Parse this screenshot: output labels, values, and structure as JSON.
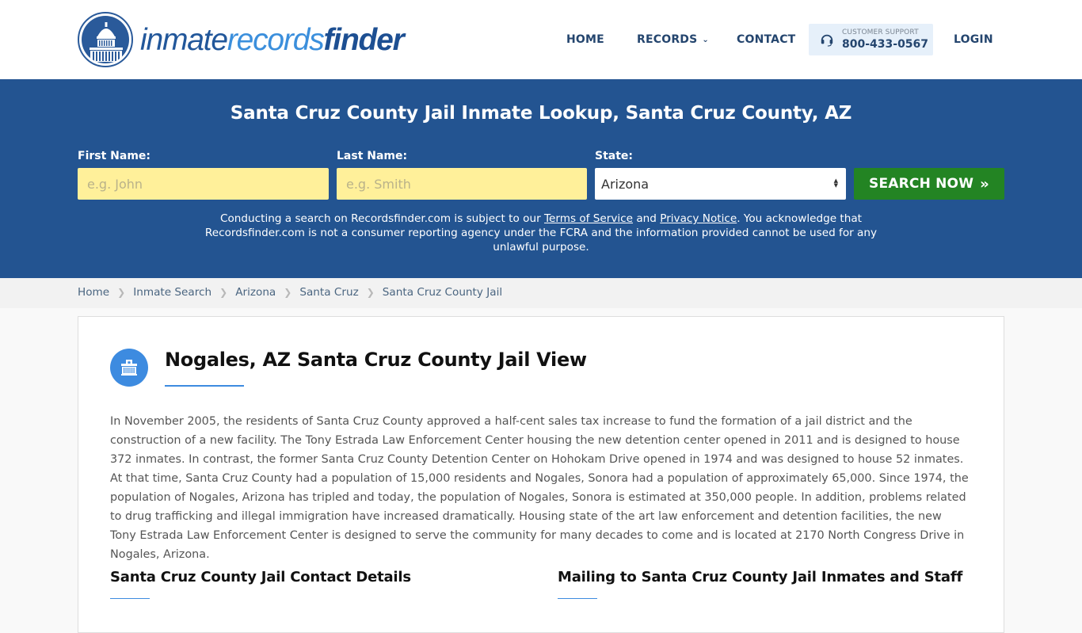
{
  "header": {
    "logo": {
      "part1": "inmate",
      "part2": "records",
      "part3": "finder",
      "emblem": "capitol-dome-icon"
    },
    "nav": {
      "home": "HOME",
      "records": "RECORDS",
      "records_icon": "chevron-down-icon",
      "contact": "CONTACT",
      "support_label": "CUSTOMER SUPPORT",
      "support_phone": "800-433-0567",
      "support_icon": "headset-icon",
      "login": "LOGIN"
    }
  },
  "hero": {
    "title": "Santa Cruz County Jail Inmate Lookup, Santa Cruz County, AZ",
    "first_name_label": "First Name:",
    "first_name_placeholder": "e.g. John",
    "first_name_value": "",
    "last_name_label": "Last Name:",
    "last_name_placeholder": "e.g. Smith",
    "last_name_value": "",
    "state_label": "State:",
    "state_value": "Arizona",
    "search_button": "SEARCH NOW",
    "search_button_icon": "double-chevron-right-icon",
    "disclaimer": {
      "part1": "Conducting a search on Recordsfinder.com is subject to our ",
      "terms_link": "Terms of Service",
      "part2": " and ",
      "privacy_link": "Privacy Notice",
      "part3": ". You acknowledge that Recordsfinder.com is not a consumer reporting agency under the FCRA and the information provided cannot be used for any unlawful purpose."
    }
  },
  "breadcrumbs": [
    "Home",
    "Inmate Search",
    "Arizona",
    "Santa Cruz",
    "Santa Cruz County Jail"
  ],
  "main": {
    "icon": "jail-building-icon",
    "title": "Nogales, AZ Santa Cruz County Jail View",
    "body": "In November 2005, the residents of Santa Cruz County approved a half-cent sales tax increase to fund the formation of a jail district and the construction of a new facility. The Tony Estrada Law Enforcement Center housing the new detention center opened in 2011 and is designed to house 372 inmates. In contrast, the former Santa Cruz County Detention Center on Hohokam Drive opened in 1974 and was designed to house 52 inmates. At that time, Santa Cruz County had a population of 15,000 residents and Nogales, Sonora had a population of approximately 65,000. Since 1974, the population of Nogales, Arizona has tripled and today, the population of Nogales, Sonora is estimated at 350,000 people. In addition, problems related to drug trafficking and illegal immigration have increased dramatically. Housing state of the art law enforcement and detention facilities, the new Tony Estrada Law Enforcement Center is designed to serve the community for many decades to come and is located at 2170 North Congress Drive in Nogales, Arizona.",
    "contact_heading": "Santa Cruz County Jail Contact Details",
    "mailing_heading": "Mailing to Santa Cruz County Jail Inmates and Staff"
  },
  "colors": {
    "brand_blue": "#235491",
    "accent_blue": "#3d8be0",
    "search_green": "#238423",
    "input_yellow": "#fff09a",
    "nav_text": "#24456e"
  }
}
